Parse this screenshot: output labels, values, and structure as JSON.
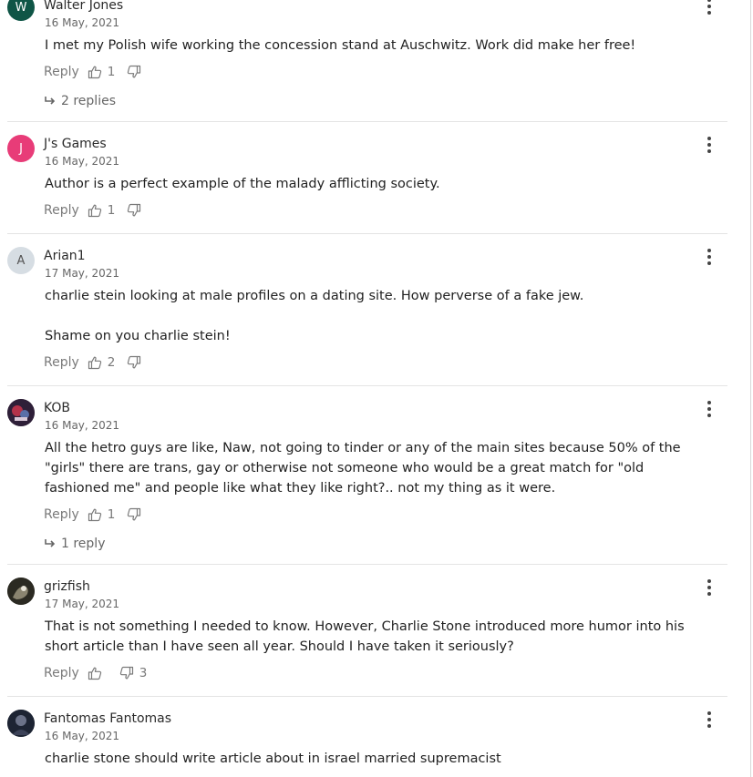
{
  "labels": {
    "reply": "Reply"
  },
  "comments": [
    {
      "author": "Walter Jones",
      "initial": "W",
      "avatar_color": "#0f5546",
      "date": "16 May, 2021",
      "lines": [
        "I met my Polish wife working the concession stand at Auschwitz. Work did make her free!"
      ],
      "likes": "1",
      "dislikes": "",
      "replies": "2 replies"
    },
    {
      "author": "J's Games",
      "initial": "J",
      "avatar_color": "#e83c78",
      "date": "16 May, 2021",
      "lines": [
        "Author is a perfect example of the malady afflicting society."
      ],
      "likes": "1",
      "dislikes": ""
    },
    {
      "author": "Arian1",
      "initial": "A",
      "avatar_color": "#d6dde3",
      "date": "17 May, 2021",
      "lines": [
        "charlie stein looking at male profiles on a dating site. How perverse of a fake jew.",
        "Shame on you charlie stein!"
      ],
      "likes": "2",
      "dislikes": ""
    },
    {
      "author": "KOB",
      "initial": "",
      "avatar_color": "#3a2a3a",
      "date": "16 May, 2021",
      "lines": [
        "All the hetro guys are like, Naw,  not going to tinder or any of the main sites because 50% of the",
        "\"girls\" there are  trans, gay or otherwise not someone who would be a great match for \"old",
        "fashioned me\"  and people like what they like right?.. not my thing as it were."
      ],
      "likes": "1",
      "dislikes": "",
      "replies": "1 reply"
    },
    {
      "author": "grizfish",
      "initial": "",
      "avatar_color": "#2b2a22",
      "date": "17 May, 2021",
      "lines": [
        "That is not something I needed to know.  However, Charlie Stone introduced more humor into his",
        "short article than I have seen all year.  Should I have taken it seriously?"
      ],
      "likes": "",
      "dislikes": "3"
    },
    {
      "author": "Fantomas Fantomas",
      "initial": "",
      "avatar_color": "#1d2433",
      "date": "16 May, 2021",
      "lines": [
        "charlie stone should write  article about in israel married supremacist"
      ],
      "likes": "",
      "dislikes": ""
    }
  ]
}
